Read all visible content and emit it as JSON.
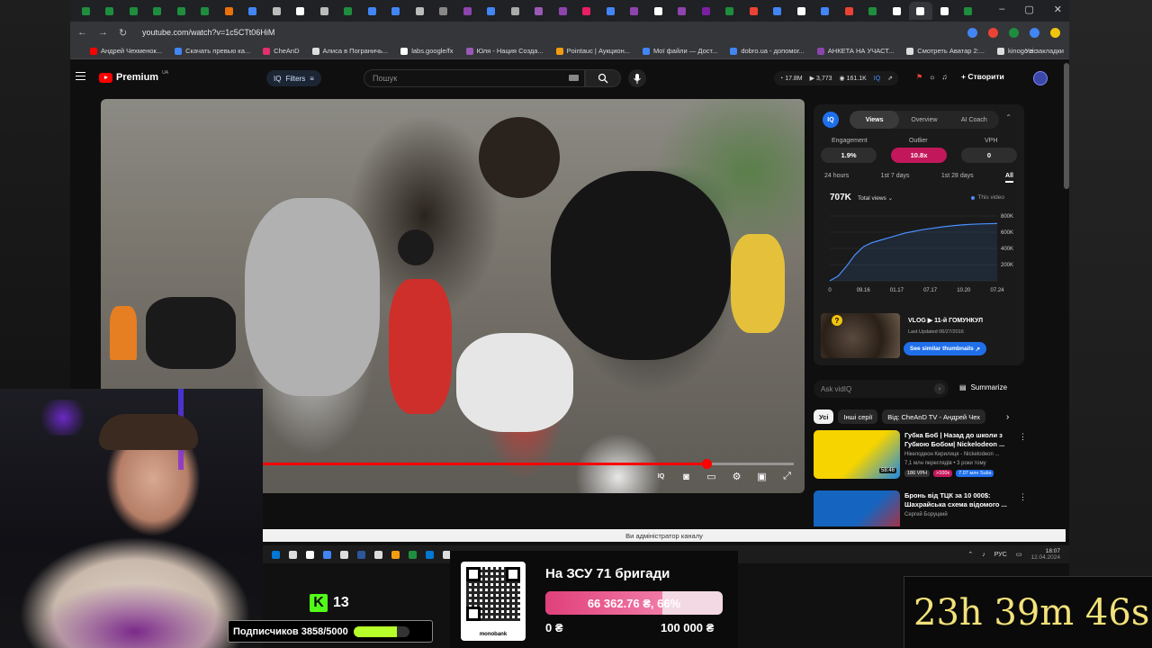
{
  "browser": {
    "url": "youtube.com/watch?v=1c5CTt06HiM",
    "tab_colors": [
      "#1e8e3e",
      "#1e8e3e",
      "#1e8e3e",
      "#1e8e3e",
      "#1e8e3e",
      "#1e8e3e",
      "#e8710a",
      "#4285f4",
      "#bbbbbb",
      "#ffffff",
      "#bbbbbb",
      "#1e8e3e",
      "#4285f4",
      "#4285f4",
      "#bbbbbb",
      "#888888",
      "#8e44ad",
      "#4285f4",
      "#aaaaaa",
      "#9b59b6",
      "#8e44ad",
      "#e91e63",
      "#4285f4",
      "#8e44ad",
      "#ffffff",
      "#8e44ad",
      "#7b1fa2",
      "#1e8e3e",
      "#ea4335",
      "#4285f4",
      "#ffffff",
      "#4285f4",
      "#ea4335",
      "#1e8e3e",
      "#ffffff",
      "#ffffff",
      "#ffffff",
      "#1e8e3e"
    ],
    "bookmarks": [
      {
        "label": "Андрей Чехменок...",
        "color": "#ff0000"
      },
      {
        "label": "Скачать превью ка...",
        "color": "#4285f4"
      },
      {
        "label": "CheAnD",
        "color": "#e1306c"
      },
      {
        "label": "Алиса в Пограничь...",
        "color": "#dddddd"
      },
      {
        "label": "labs.google/fx",
        "color": "#ffffff"
      },
      {
        "label": "Юля - Нация Созда...",
        "color": "#9b59b6"
      },
      {
        "label": "Pointauc | Аукцион...",
        "color": "#f39c12"
      },
      {
        "label": "Мої файли — Дост...",
        "color": "#4285f4"
      },
      {
        "label": "dobro.ua - допомог...",
        "color": "#4285f4"
      },
      {
        "label": "АНКЕТА НА УЧАСТ...",
        "color": "#8e44ad"
      },
      {
        "label": "Смотреть Аватар 2:...",
        "color": "#dddddd"
      },
      {
        "label": "kinogo.ec",
        "color": "#dddddd"
      }
    ],
    "all_bookmarks": "Усі закладки"
  },
  "youtube": {
    "logo": "Premium",
    "logo_sup": "UA",
    "filters_label": "Filters",
    "search_placeholder": "Пошук",
    "stats": {
      "subs": "17.8M",
      "videos": "3,773",
      "views": "161.1K"
    },
    "create_label": "Створити"
  },
  "player": {
    "progress_fraction": 0.835,
    "controls": [
      "vidiq-icon",
      "stop-icon",
      "subtitles-icon",
      "settings-icon",
      "theater-icon",
      "fullscreen-icon"
    ]
  },
  "vidiq": {
    "logo": "IQ",
    "tabs": [
      {
        "label": "Views",
        "active": true
      },
      {
        "label": "Overview",
        "active": false
      },
      {
        "label": "AI Coach",
        "active": false
      }
    ],
    "metrics": [
      {
        "label": "Engagement",
        "value": "1.9%",
        "color": "#2e2e2e"
      },
      {
        "label": "Outlier",
        "value": "10.8x",
        "color": "#c2185b"
      },
      {
        "label": "VPH",
        "value": "0",
        "color": "#2e2e2e"
      }
    ],
    "ranges": [
      {
        "label": "24 hours",
        "active": false
      },
      {
        "label": "1st 7 days",
        "active": false
      },
      {
        "label": "1st 28 days",
        "active": false
      },
      {
        "label": "All",
        "active": true
      }
    ],
    "views_total": "707K",
    "views_selector": "Total views",
    "legend": "This video",
    "thumb": {
      "title": "VLOG ▶ 11-й ГОМУНКУЛ",
      "updated": "Last Updated 06/27/2016",
      "button": "See similar thumbnails"
    },
    "ask_placeholder": "Ask vidIQ",
    "summarize": "Summarize"
  },
  "chart_data": {
    "type": "line",
    "x_ticks": [
      "0",
      "09.16",
      "01.17",
      "07.17",
      "10.20",
      "07.24"
    ],
    "y_ticks": [
      "0",
      "200K",
      "400K",
      "600K",
      "800K"
    ],
    "ylim": [
      0,
      800000
    ],
    "series": [
      {
        "x": [
          0,
          0.05,
          0.1,
          0.15,
          0.2,
          0.25,
          0.3,
          0.35,
          0.4,
          0.45,
          0.5,
          0.55,
          0.6,
          0.65,
          0.7,
          0.75,
          0.8,
          0.85,
          0.9,
          0.95,
          1.0
        ],
        "values": [
          0,
          60000,
          180000,
          320000,
          420000,
          470000,
          500000,
          530000,
          560000,
          590000,
          610000,
          630000,
          645000,
          660000,
          672000,
          683000,
          692000,
          698000,
          702000,
          705000,
          707000
        ]
      }
    ]
  },
  "chips": [
    {
      "label": "Усі",
      "active": true
    },
    {
      "label": "Інші серії",
      "active": false
    },
    {
      "label": "Від: CheAnD TV - Андрей Чех",
      "active": false
    }
  ],
  "recommendations": [
    {
      "title": "Губка Боб | Назад до школи з Губкою Бобом| Nickelodeon ...",
      "channel": "Нікелодеон Кирилиця - Nickelodeon ...",
      "meta": "7,1 млн переглядів • 3 роки тому",
      "duration": "58:46",
      "badges": [
        {
          "text": "186 VPH",
          "color": "#333333"
        },
        {
          "text": ">100x",
          "color": "#c2185b"
        },
        {
          "text": "7.07 млн Subs",
          "color": "#1f6feb"
        }
      ],
      "thumb_colors": [
        "#f5d400",
        "#1e88e5"
      ]
    },
    {
      "title": "Бронь від ТЦК за 10 000$: Шахрайська схема відомого ...",
      "channel": "Сергей Боруцкий",
      "meta": "",
      "duration": "",
      "badges": [],
      "thumb_colors": [
        "#1565c0",
        "#c62828"
      ]
    }
  ],
  "admin_notice": "Ви адміністратор каналу",
  "taskbar": {
    "lang": "РУС",
    "time": "18:07",
    "date": "12.04.2024",
    "icons": [
      "#0078d4",
      "#dddddd",
      "#ffffff",
      "#4285f4",
      "#dddddd",
      "#2b579a",
      "#dddddd",
      "#f39c12",
      "#1e8e3e",
      "#0078d4",
      "#dddddd",
      "#ea4335"
    ]
  },
  "stream": {
    "kick_logo": "K",
    "kick_count": "13",
    "subs_text": "Подписчиков 3858/5000",
    "subs_fraction": 0.7716,
    "donate_title": "На ЗСУ 71 бригади",
    "donate_progress_text": "66 362.76 ₴, 66%",
    "donate_fraction": 0.66,
    "donate_min": "0 ₴",
    "donate_max": "100 000 ₴",
    "qr_label": "monobank",
    "timer": "23h 39m 46s"
  }
}
